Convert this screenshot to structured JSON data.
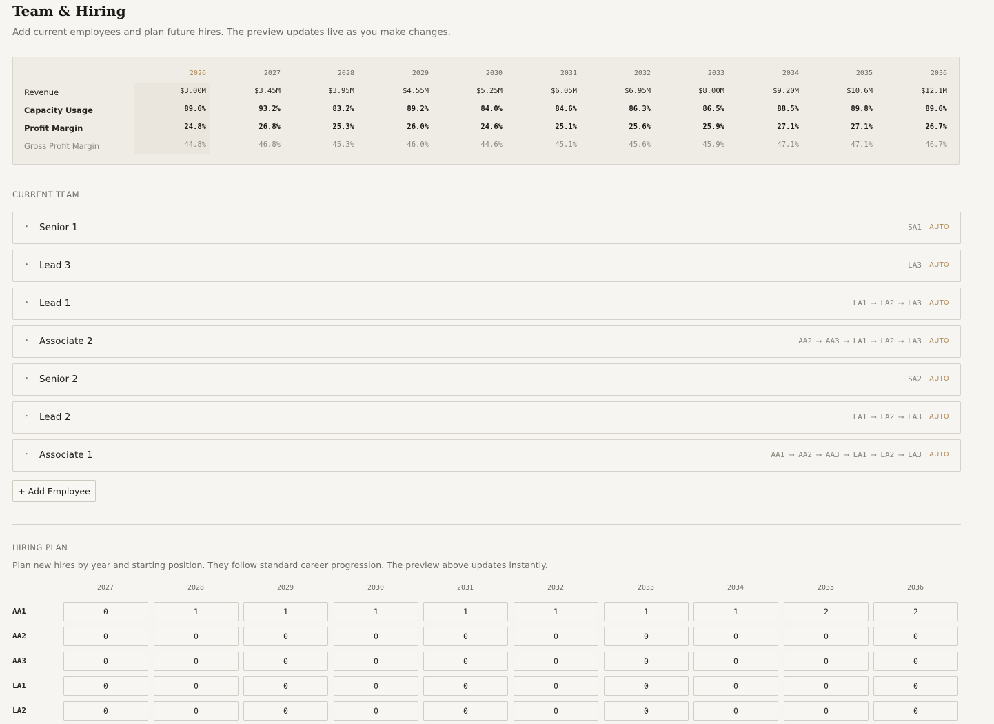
{
  "header": {
    "title": "Team & Hiring",
    "subtitle": "Add current employees and plan future hires. The preview updates live as you make changes."
  },
  "preview": {
    "years": [
      "2026",
      "2027",
      "2028",
      "2029",
      "2030",
      "2031",
      "2032",
      "2033",
      "2034",
      "2035",
      "2036"
    ],
    "rows": [
      {
        "label": "Revenue",
        "style": "normal",
        "values": [
          "$3.00M",
          "$3.45M",
          "$3.95M",
          "$4.55M",
          "$5.25M",
          "$6.05M",
          "$6.95M",
          "$8.00M",
          "$9.20M",
          "$10.6M",
          "$12.1M"
        ]
      },
      {
        "label": "Capacity Usage",
        "style": "bold",
        "values": [
          "89.6%",
          "93.2%",
          "83.2%",
          "89.2%",
          "84.0%",
          "84.6%",
          "86.3%",
          "86.5%",
          "88.5%",
          "89.8%",
          "89.6%"
        ]
      },
      {
        "label": "Profit Margin",
        "style": "bold",
        "values": [
          "24.8%",
          "26.8%",
          "25.3%",
          "26.0%",
          "24.6%",
          "25.1%",
          "25.6%",
          "25.9%",
          "27.1%",
          "27.1%",
          "26.7%"
        ]
      },
      {
        "label": "Gross Profit Margin",
        "style": "muted",
        "values": [
          "44.8%",
          "46.8%",
          "45.3%",
          "46.0%",
          "44.6%",
          "45.1%",
          "45.6%",
          "45.9%",
          "47.1%",
          "47.1%",
          "46.7%"
        ]
      }
    ]
  },
  "current_team": {
    "label": "CURRENT TEAM",
    "auto_label": "AUTO",
    "employees": [
      {
        "name": "Senior 1",
        "path": "SA1"
      },
      {
        "name": "Lead 3",
        "path": "LA3"
      },
      {
        "name": "Lead 1",
        "path": "LA1 ⟶ LA2 ⟶ LA3"
      },
      {
        "name": "Associate 2",
        "path": "AA2 ⟶ AA3 ⟶ LA1 ⟶ LA2 ⟶ LA3"
      },
      {
        "name": "Senior 2",
        "path": "SA2"
      },
      {
        "name": "Lead 2",
        "path": "LA1 ⟶ LA2 ⟶ LA3"
      },
      {
        "name": "Associate 1",
        "path": "AA1 ⟶ AA2 ⟶ AA3 ⟶ LA1 ⟶ LA2 ⟶ LA3"
      }
    ],
    "add_button": "+ Add Employee"
  },
  "hiring_plan": {
    "label": "HIRING PLAN",
    "description": "Plan new hires by year and starting position. They follow standard career progression. The preview above updates instantly.",
    "years": [
      "2027",
      "2028",
      "2029",
      "2030",
      "2031",
      "2032",
      "2033",
      "2034",
      "2035",
      "2036"
    ],
    "rows": [
      {
        "position": "AA1",
        "values": [
          "0",
          "1",
          "1",
          "1",
          "1",
          "1",
          "1",
          "1",
          "2",
          "2"
        ]
      },
      {
        "position": "AA2",
        "values": [
          "0",
          "0",
          "0",
          "0",
          "0",
          "0",
          "0",
          "0",
          "0",
          "0"
        ]
      },
      {
        "position": "AA3",
        "values": [
          "0",
          "0",
          "0",
          "0",
          "0",
          "0",
          "0",
          "0",
          "0",
          "0"
        ]
      },
      {
        "position": "LA1",
        "values": [
          "0",
          "0",
          "0",
          "0",
          "0",
          "0",
          "0",
          "0",
          "0",
          "0"
        ]
      },
      {
        "position": "LA2",
        "values": [
          "0",
          "0",
          "0",
          "0",
          "0",
          "0",
          "0",
          "0",
          "0",
          "0"
        ]
      }
    ]
  },
  "colors": {
    "accent": "#b08552",
    "background": "#f6f5f1",
    "preview_bg": "#efece6"
  }
}
